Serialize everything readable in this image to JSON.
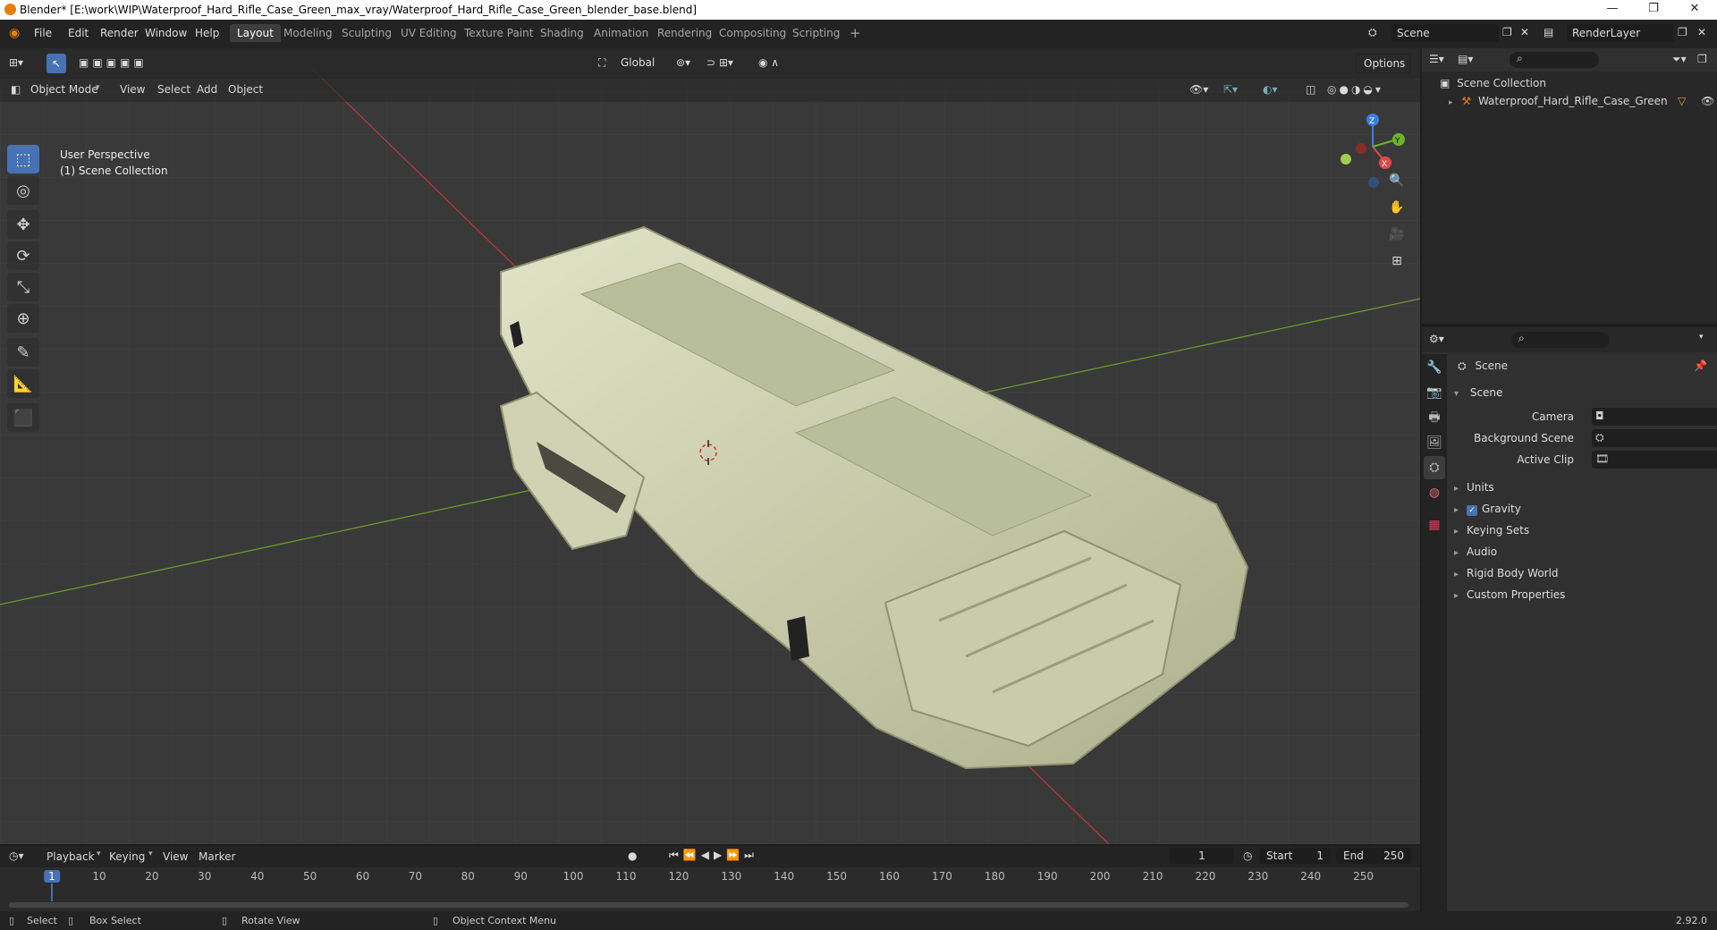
{
  "window": {
    "title": "Blender* [E:\\work\\WIP\\Waterproof_Hard_Rifle_Case_Green_max_vray/Waterproof_Hard_Rifle_Case_Green_blender_base.blend]"
  },
  "menu": [
    "File",
    "Edit",
    "Render",
    "Window",
    "Help"
  ],
  "workspaces": [
    "Layout",
    "Modeling",
    "Sculpting",
    "UV Editing",
    "Texture Paint",
    "Shading",
    "Animation",
    "Rendering",
    "Compositing",
    "Scripting"
  ],
  "active_workspace": "Layout",
  "scene_field": "Scene",
  "render_layer_field": "RenderLayer",
  "viewport": {
    "mode": "Object Mode",
    "menus": [
      "View",
      "Select",
      "Add",
      "Object"
    ],
    "transform_orientation": "Global",
    "options_label": "Options",
    "perspective_label": "User Perspective",
    "collection_label": "(1) Scene Collection",
    "gizmo_axes": {
      "x": "X",
      "y": "Y",
      "z": "Z"
    }
  },
  "outliner": {
    "root": "Scene Collection",
    "items": [
      {
        "label": "Waterproof_Hard_Rifle_Case_Green"
      }
    ]
  },
  "properties": {
    "context_title": "Scene",
    "section": "Scene",
    "fields": [
      {
        "label": "Camera",
        "value": ""
      },
      {
        "label": "Background Scene",
        "value": ""
      },
      {
        "label": "Active Clip",
        "value": ""
      }
    ],
    "panels": [
      "Units",
      "Gravity",
      "Keying Sets",
      "Audio",
      "Rigid Body World",
      "Custom Properties"
    ],
    "gravity_checked": true
  },
  "timeline": {
    "menus": [
      "Playback",
      "Keying",
      "View",
      "Marker"
    ],
    "current_frame": "1",
    "start_label": "Start",
    "start": "1",
    "end_label": "End",
    "end": "250",
    "ticks": [
      "1",
      "10",
      "20",
      "30",
      "40",
      "50",
      "60",
      "70",
      "80",
      "90",
      "100",
      "110",
      "120",
      "130",
      "140",
      "150",
      "160",
      "170",
      "180",
      "190",
      "200",
      "210",
      "220",
      "230",
      "240",
      "250"
    ]
  },
  "statusbar": {
    "select": "Select",
    "box_select": "Box Select",
    "rotate_view": "Rotate View",
    "context_menu": "Object Context Menu",
    "version": "2.92.0"
  },
  "colors": {
    "accent": "#4772b3",
    "axis_x": "#e04a4a",
    "axis_y": "#6fb42a",
    "axis_z": "#3b7de0",
    "model": "#d2d6b3"
  }
}
